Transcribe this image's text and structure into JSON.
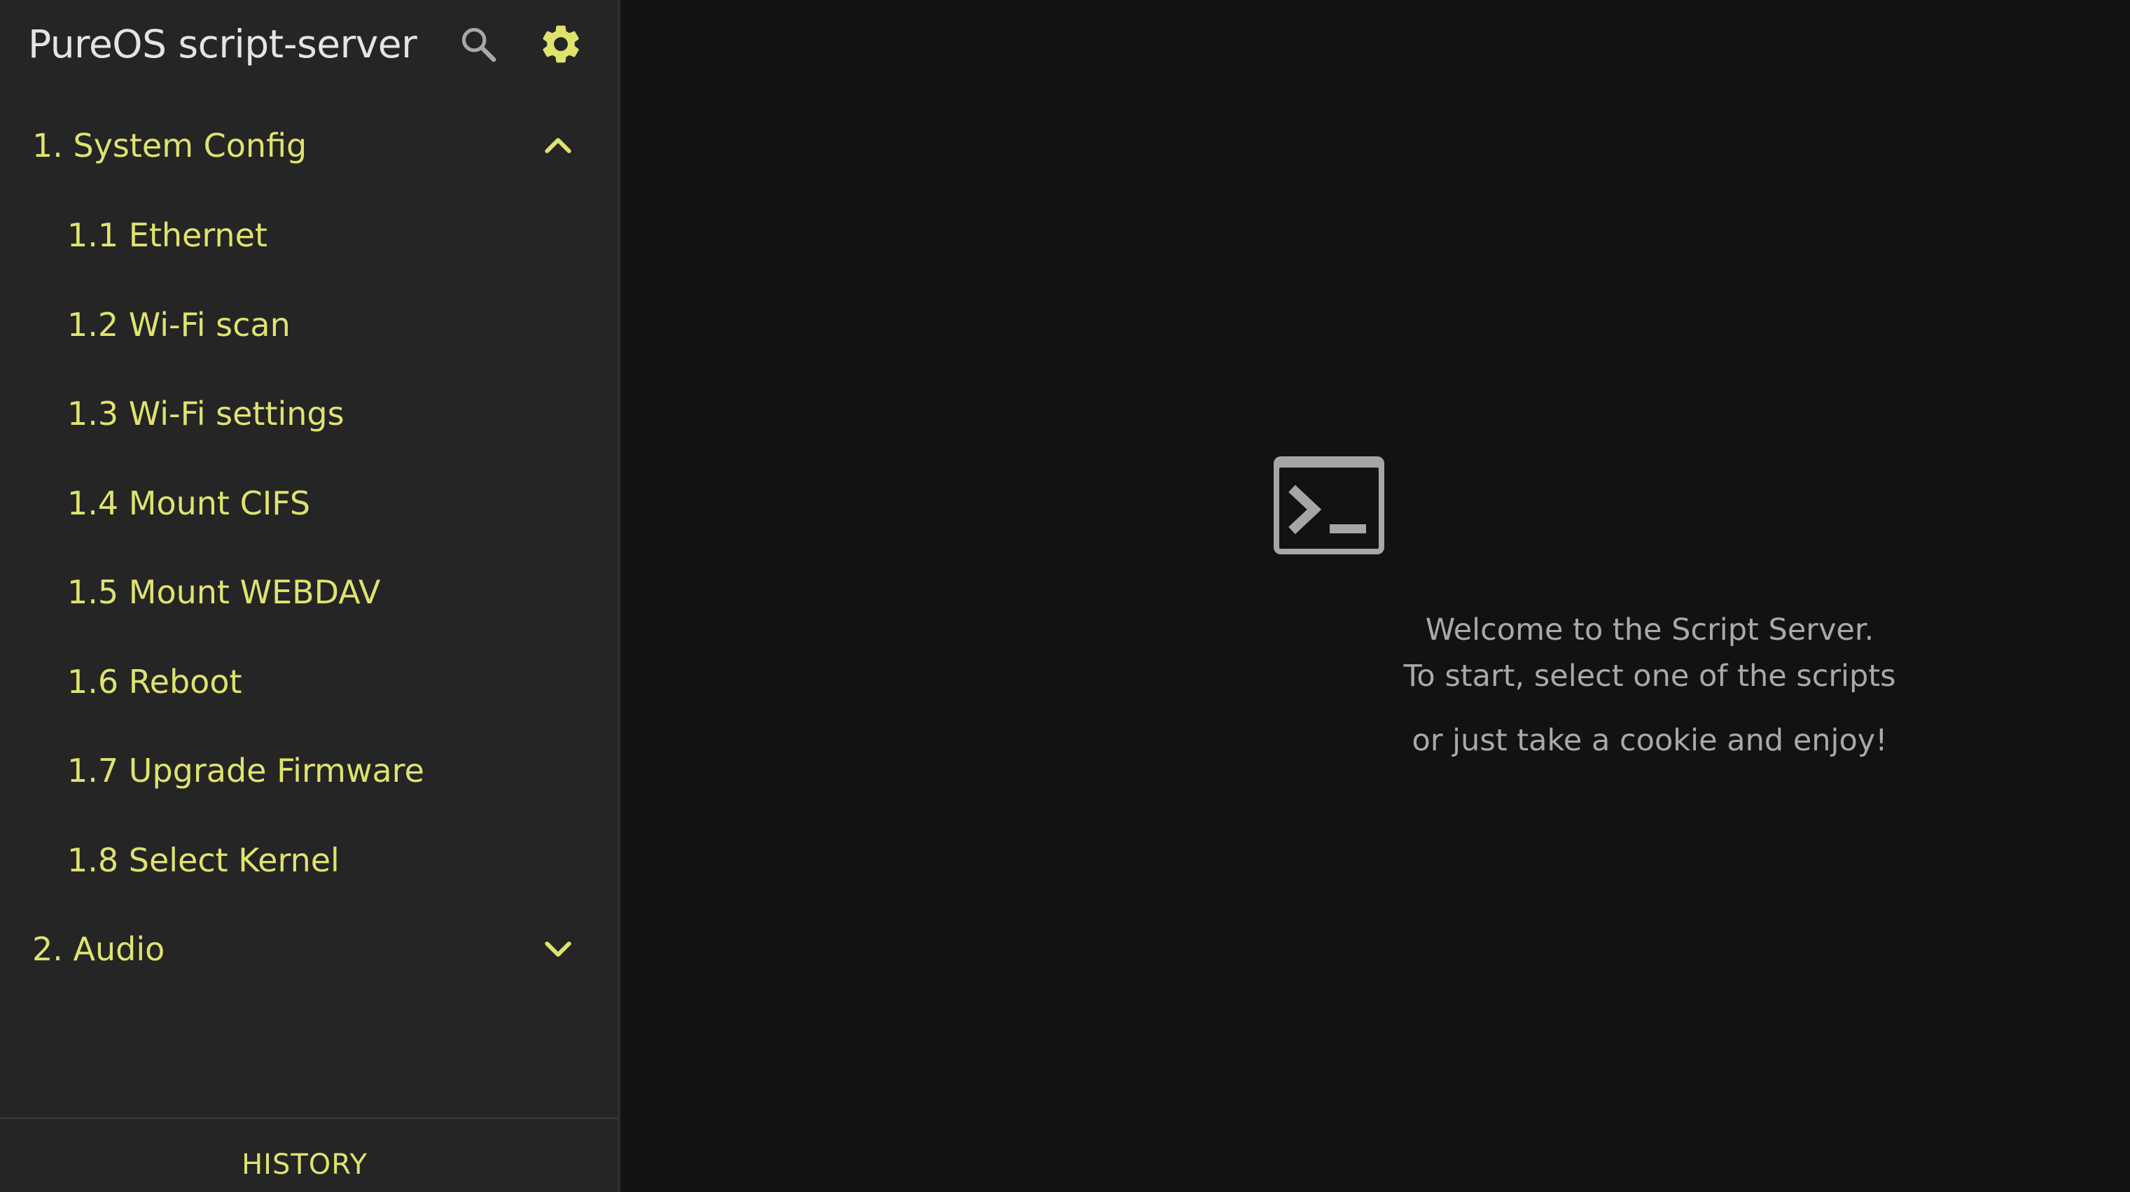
{
  "app": {
    "title": "PureOS script-server"
  },
  "header": {
    "search_icon": "search-icon",
    "settings_icon": "gear-icon"
  },
  "groups": [
    {
      "label": "1. System Config",
      "expanded": true,
      "items": [
        {
          "label": "1.1 Ethernet"
        },
        {
          "label": "1.2 Wi-Fi scan"
        },
        {
          "label": "1.3 Wi-Fi settings"
        },
        {
          "label": "1.4 Mount CIFS"
        },
        {
          "label": "1.5 Mount WEBDAV"
        },
        {
          "label": "1.6 Reboot"
        },
        {
          "label": "1.7 Upgrade Firmware"
        },
        {
          "label": "1.8 Select Kernel"
        }
      ]
    },
    {
      "label": "2. Audio",
      "expanded": false,
      "items": []
    }
  ],
  "footer": {
    "history_label": "HISTORY"
  },
  "welcome": {
    "icon": "terminal-icon",
    "line1": "Welcome to the Script Server.",
    "line2": "To start, select one of the scripts",
    "line3": "or just take a cookie and enjoy!"
  },
  "colors": {
    "accent": "#dfe36e",
    "sidebar_bg": "#252525",
    "main_bg": "#121212",
    "muted_text": "#a9a9a9"
  }
}
